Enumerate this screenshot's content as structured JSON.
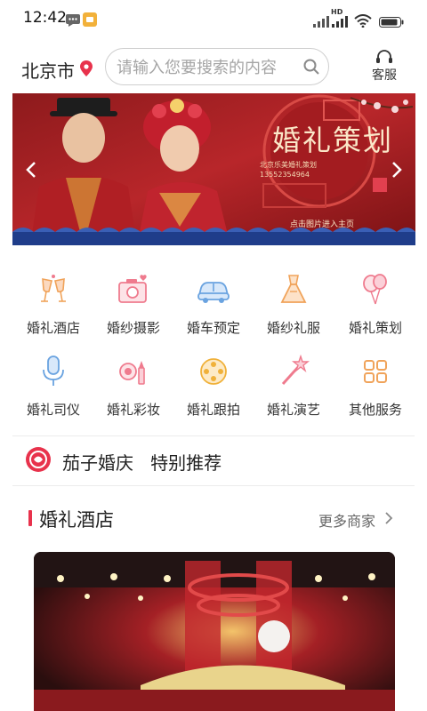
{
  "status_bar": {
    "time": "12:42",
    "network_label": "HD"
  },
  "header": {
    "city": "北京市",
    "search_placeholder": "请输入您要搜索的内容",
    "service_label": "客服"
  },
  "banner": {
    "title": "婚礼策划",
    "company": "北京乐美婚礼策划",
    "phone": "13552354964",
    "link_text": "点击图片进入主页"
  },
  "categories": [
    {
      "label": "婚礼酒店",
      "icon": "champagne-glasses-icon"
    },
    {
      "label": "婚纱摄影",
      "icon": "camera-heart-icon"
    },
    {
      "label": "婚车预定",
      "icon": "car-icon"
    },
    {
      "label": "婚纱礼服",
      "icon": "wedding-dress-icon"
    },
    {
      "label": "婚礼策划",
      "icon": "balloons-icon"
    },
    {
      "label": "婚礼司仪",
      "icon": "microphone-icon"
    },
    {
      "label": "婚礼彩妆",
      "icon": "makeup-icon"
    },
    {
      "label": "婚礼跟拍",
      "icon": "film-reel-icon"
    },
    {
      "label": "婚礼演艺",
      "icon": "magic-wand-icon"
    },
    {
      "label": "其他服务",
      "icon": "grid-squares-icon"
    }
  ],
  "recommend": {
    "text": "茄子婚庆   特别推荐"
  },
  "section": {
    "title": "婚礼酒店",
    "more_label": "更多商家"
  },
  "colors": {
    "accent": "#e8324c",
    "icon_orange": "#f0a35a",
    "icon_blue": "#6aa3e0",
    "icon_pink": "#ef7b8e"
  }
}
